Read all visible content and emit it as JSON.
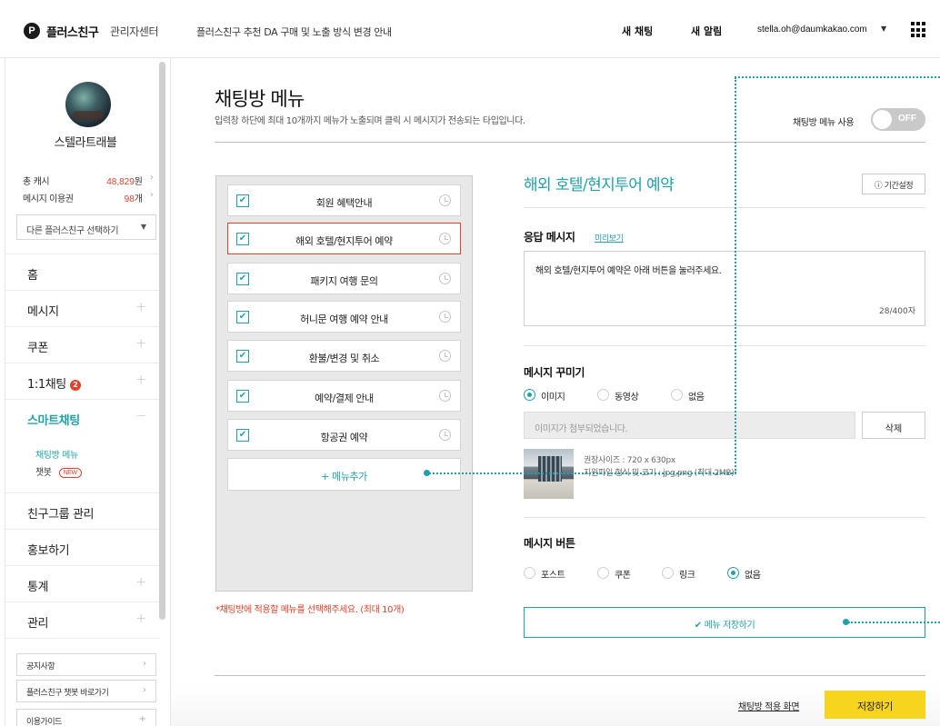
{
  "header": {
    "logo_mark": "P",
    "logo_text": "플러스친구",
    "logo_sub": "관리자센터",
    "notice": "플러스친구 추천 DA 구매 및 노출 방식 변경 안내",
    "new_chat": "새 채팅",
    "new_alert": "새 알림",
    "email": "stella.oh@daumkakao.com",
    "caret": "▼"
  },
  "sidebar": {
    "profile_name": "스텔라트래블",
    "cash_label": "총 캐시",
    "cash_value": "48,829",
    "cash_unit": "원",
    "msg_label": "메시지 이용권",
    "msg_value": "98",
    "msg_unit": "개",
    "arrow": "›",
    "select_text": "다른 플러스친구 선택하기",
    "select_caret": "▼",
    "nav": {
      "home": "홈",
      "message": "메시지",
      "coupon": "쿠폰",
      "chat": "1:1채팅",
      "chat_badge": "2",
      "smart_chat": "스마트채팅",
      "friend_group": "친구그룹 관리",
      "promote": "홍보하기",
      "stats": "통계",
      "manage": "관리"
    },
    "plus": "+",
    "minus": "−",
    "sub": {
      "chat_menu": "채팅방 메뉴",
      "chatbot": "챗봇",
      "new_badge": "NEW"
    },
    "links": {
      "notice": "공지사항",
      "chatbot_shortcut": "플러스친구 챗봇 바로가기",
      "guide": "이용가이드"
    }
  },
  "main": {
    "title": "채팅방 메뉴",
    "description": "입력창 하단에 최대 10개까지 메뉴가 노출되며 클릭 시 메시지가 전송되는 타입입니다.",
    "toggle_label": "채팅방 메뉴 사용",
    "toggle_state": "OFF",
    "menu_items": [
      {
        "label": "회원 혜택안내",
        "checked": true
      },
      {
        "label": "해외 호텔/현지투어 예약",
        "checked": true
      },
      {
        "label": "패키지 여행 문의",
        "checked": true
      },
      {
        "label": "허니문 여행 예약 안내",
        "checked": true
      },
      {
        "label": "환불/변경 및 취소",
        "checked": true
      },
      {
        "label": "예약/결제 안내",
        "checked": true
      },
      {
        "label": "항공권 예약",
        "checked": true
      }
    ],
    "check_glyph": "✔",
    "add_menu": "+ 메뉴추가",
    "panel_note": "*채팅방에 적용할 메뉴를 선택해주세요. (최대 10개)"
  },
  "detail": {
    "title": "해외 호텔/현지투어 예약",
    "period_button": "ⓘ 기간설정",
    "response_label": "응답 메시지",
    "preview_link": "미리보기",
    "message_text": "해외 호텔/현지투어 예약은 아래 버튼을 눌러주세요.",
    "char_count": "28/400자",
    "decorate_label": "메시지 꾸미기",
    "decorate_options": [
      "이미지",
      "동영상",
      "없음"
    ],
    "decorate_selected": "이미지",
    "attach_placeholder": "이미지가 첨부되었습니다.",
    "delete_button": "삭제",
    "spec_size": "권장사이즈 : 720 x 630px",
    "spec_format": "지원파일 형식 및 크기 : jpg,png (최대 2MB)",
    "button_label": "메시지 버튼",
    "button_options": [
      "포스트",
      "쿠폰",
      "링크",
      "없음"
    ],
    "button_selected": "없음",
    "save_menu": "메뉴 저장하기",
    "save_check": "✔"
  },
  "footer": {
    "apply_link": "채팅방 적용 화면",
    "save_button": "저장하기"
  },
  "colors": {
    "accent": "#21a1a8",
    "alert": "#e2412d",
    "save_yellow": "#f7d51e"
  }
}
